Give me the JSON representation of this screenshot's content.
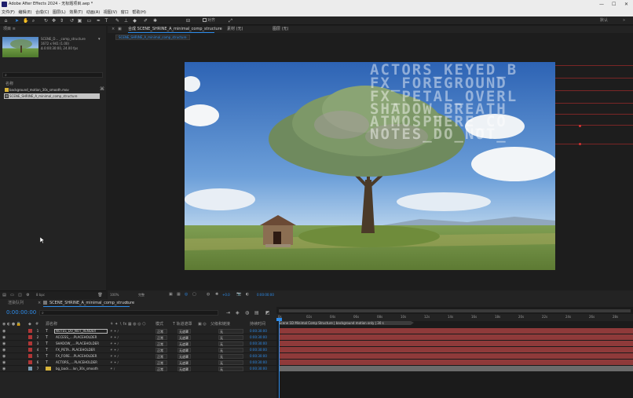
{
  "window": {
    "title": "Adobe After Effects 2024 - 无标题项目.aep *",
    "controls": [
      "—",
      "☐",
      "✕"
    ]
  },
  "menu": [
    "文件(F)",
    "编辑(E)",
    "合成(C)",
    "图层(L)",
    "效果(T)",
    "动画(A)",
    "视图(V)",
    "窗口",
    "帮助(H)"
  ],
  "toolbar": {
    "snap_label": "对齐",
    "workspace": [
      "默认",
      "»"
    ]
  },
  "project": {
    "tab": "项目 ≡",
    "comp_name": "SCENE_D... _comp_structure",
    "comp_dims": "1672 x 941 (1.00)",
    "comp_duration": "Δ 0:00:30:00, 24.00 fps",
    "search_icon": "⌕",
    "col_name": "名称",
    "items": [
      {
        "name": "background_motion_30s_smooth.mov",
        "type": "footage"
      },
      {
        "name": "SCENE_SHRINE_A_minimal_comp_structure",
        "type": "comp",
        "selected": true
      }
    ],
    "bottom_bpc": "8 bpc"
  },
  "composition": {
    "tabs": [
      {
        "label": "合成 SCENE_SHRINE_A_minimal_comp_structure",
        "active": true
      },
      {
        "label": "素材 (无)"
      },
      {
        "label": "图层 (无)"
      }
    ],
    "subtab": "SCENE_SHRINE_A_minimal_comp_structure",
    "overlay_lines": [
      "ACTORS_KEYED_B",
      "FX_FOREGROUND",
      "FX_PETAL_OVERL",
      "SHADOW_BREATH",
      "ATMOSPHERE_CO",
      "NOTES_DO_NOT_"
    ],
    "footer": {
      "zoom": "100%",
      "resolution": "完整",
      "exposure": "+0.0",
      "timecode": "0:00:00:00"
    }
  },
  "timeline": {
    "tabs": [
      {
        "label": "渲染队列"
      },
      {
        "label": "SCENE_SHRINE_A_minimal_comp_structure",
        "active": true
      }
    ],
    "current_time": "0:00:00:00",
    "search_icon": "⌕",
    "headers": {
      "source_name": "源名称",
      "mode": "模式",
      "trkmat": "T 轨道遮罩",
      "parent": "父级和链接",
      "duration": "持续时间"
    },
    "layers": [
      {
        "num": "1",
        "name": "NOTES_DO_NOT_RENDER",
        "mode": "正常",
        "trkmat": "无遮罩",
        "parent": "无",
        "duration": "0:00:30:00",
        "selected": true
      },
      {
        "num": "2",
        "name": "ACCESS_....PLACEHOLDER",
        "mode": "正常",
        "trkmat": "无遮罩",
        "parent": "无",
        "duration": "0:00:30:00"
      },
      {
        "num": "3",
        "name": "SHADOW_....PLACEHOLDER",
        "mode": "正常",
        "trkmat": "无遮罩",
        "parent": "无",
        "duration": "0:00:30:00"
      },
      {
        "num": "4",
        "name": "FX_PETA...PLACEHOLDER",
        "mode": "正常",
        "trkmat": "无遮罩",
        "parent": "无",
        "duration": "0:00:30:00"
      },
      {
        "num": "5",
        "name": "FX_FORE....PLACEHOLDER",
        "mode": "正常",
        "trkmat": "无遮罩",
        "parent": "无",
        "duration": "0:00:30:00"
      },
      {
        "num": "6",
        "name": "ACTORS_....PLACEHOLDER",
        "mode": "正常",
        "trkmat": "无遮罩",
        "parent": "无",
        "duration": "0:00:30:00"
      },
      {
        "num": "7",
        "name": "bg_back....lon_30s_smooth",
        "mode": "正常",
        "trkmat": "无遮罩",
        "parent": "无",
        "duration": "0:00:30:00"
      }
    ],
    "ruler": [
      "0s",
      "02s",
      "04s",
      "06s",
      "08s",
      "10s",
      "12s",
      "14s",
      "16s",
      "18s",
      "20s",
      "22s",
      "24s",
      "26s",
      "28s"
    ],
    "track_note": "Scene 1D Minimal Comp Structure | background motion only | 30 s"
  },
  "colors": {
    "accent": "#2d8ceb",
    "layer_red": "#b03636",
    "layer_red_bar": "#8f3a3a",
    "layer_gray_bar": "#6b6b6b",
    "label_yellow": "#d8b43a"
  }
}
